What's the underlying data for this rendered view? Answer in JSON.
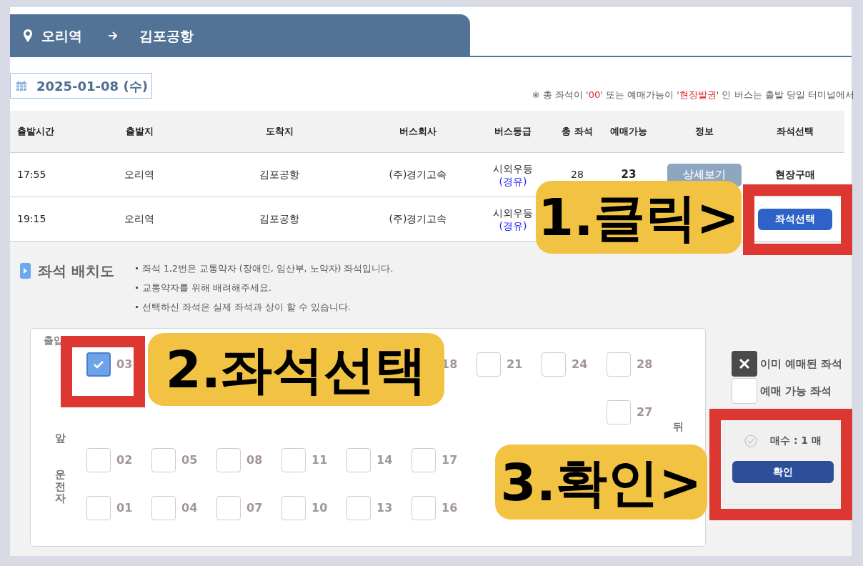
{
  "route": {
    "from": "오리역",
    "to": "김포공항"
  },
  "date": "2025-01-08 (수)",
  "notice": [
    {
      "text": "※ 총 좌석이 '",
      "emphasis": false
    },
    {
      "text": "00",
      "emphasis": true
    },
    {
      "text": "' 또는 예매가능이 '",
      "emphasis": false
    },
    {
      "text": "현장발권",
      "emphasis": true
    },
    {
      "text": "' 인 버스는 출발 당일 터미널에서",
      "emphasis": false
    }
  ],
  "table": {
    "columns": [
      "출발시간",
      "출발지",
      "도착지",
      "버스회사",
      "버스등급",
      "총 좌석",
      "예매가능",
      "정보",
      "좌석선택"
    ],
    "rows": [
      {
        "departure_time": "17:55",
        "origin": "오리역",
        "destination": "김포공항",
        "company": "(주)경기고속",
        "grade": "시외우등",
        "route_type": "(경유)",
        "total_seats": "28",
        "available": "23",
        "info_button": "상세보기",
        "seat_select": {
          "kind": "text",
          "label": "현장구매"
        }
      },
      {
        "departure_time": "19:15",
        "origin": "오리역",
        "destination": "김포공항",
        "company": "(주)경기고속",
        "grade": "시외우등",
        "route_type": "(경유)",
        "seat_select": {
          "kind": "button",
          "label": "좌석선택"
        }
      }
    ]
  },
  "seat_map": {
    "title": "좌석 배치도",
    "notes": [
      "좌석 1,2번은 교통약자 (장애인, 임산부, 노약자) 좌석입니다.",
      "교통약자를 위해 배려해주세요.",
      "선택하신 좌석은 실제 좌석과 상이 할 수 있습니다."
    ],
    "labels": {
      "entrance": "출입",
      "front": "앞",
      "driver": "운전자",
      "rear": "뒤"
    },
    "rows": [
      [
        {
          "number": "03",
          "checked": true
        },
        null,
        null,
        null,
        null,
        {
          "number": "18"
        },
        {
          "number": "21",
          "checked": false
        },
        {
          "number": "24",
          "checked": false
        },
        {
          "number": "28",
          "checked": false
        }
      ],
      [
        null,
        null,
        null,
        null,
        null,
        null,
        null,
        null,
        {
          "number": "27",
          "checked": false
        }
      ],
      [
        {
          "number": "02",
          "checked": false
        },
        {
          "number": "05",
          "checked": false
        },
        {
          "number": "08",
          "checked": false
        },
        {
          "number": "11",
          "checked": false
        },
        {
          "number": "14",
          "checked": false
        },
        {
          "number": "17",
          "checked": false
        },
        null,
        null,
        null
      ],
      [
        {
          "number": "01",
          "checked": false
        },
        {
          "number": "04",
          "checked": false
        },
        {
          "number": "07",
          "checked": false
        },
        {
          "number": "10",
          "checked": false
        },
        {
          "number": "13",
          "checked": false
        },
        {
          "number": "16",
          "checked": false
        },
        null,
        null,
        null
      ]
    ]
  },
  "legend": [
    {
      "kind": "booked",
      "label": "이미 예매된 좌석"
    },
    {
      "kind": "available",
      "label": "예매 가능 좌석"
    }
  ],
  "summary": {
    "count": "매수 : 1 매",
    "confirm": "확인"
  },
  "annotations": [
    {
      "text": "1.클릭>"
    },
    {
      "text": "2.좌석선택"
    },
    {
      "text": "3.확인>"
    }
  ]
}
